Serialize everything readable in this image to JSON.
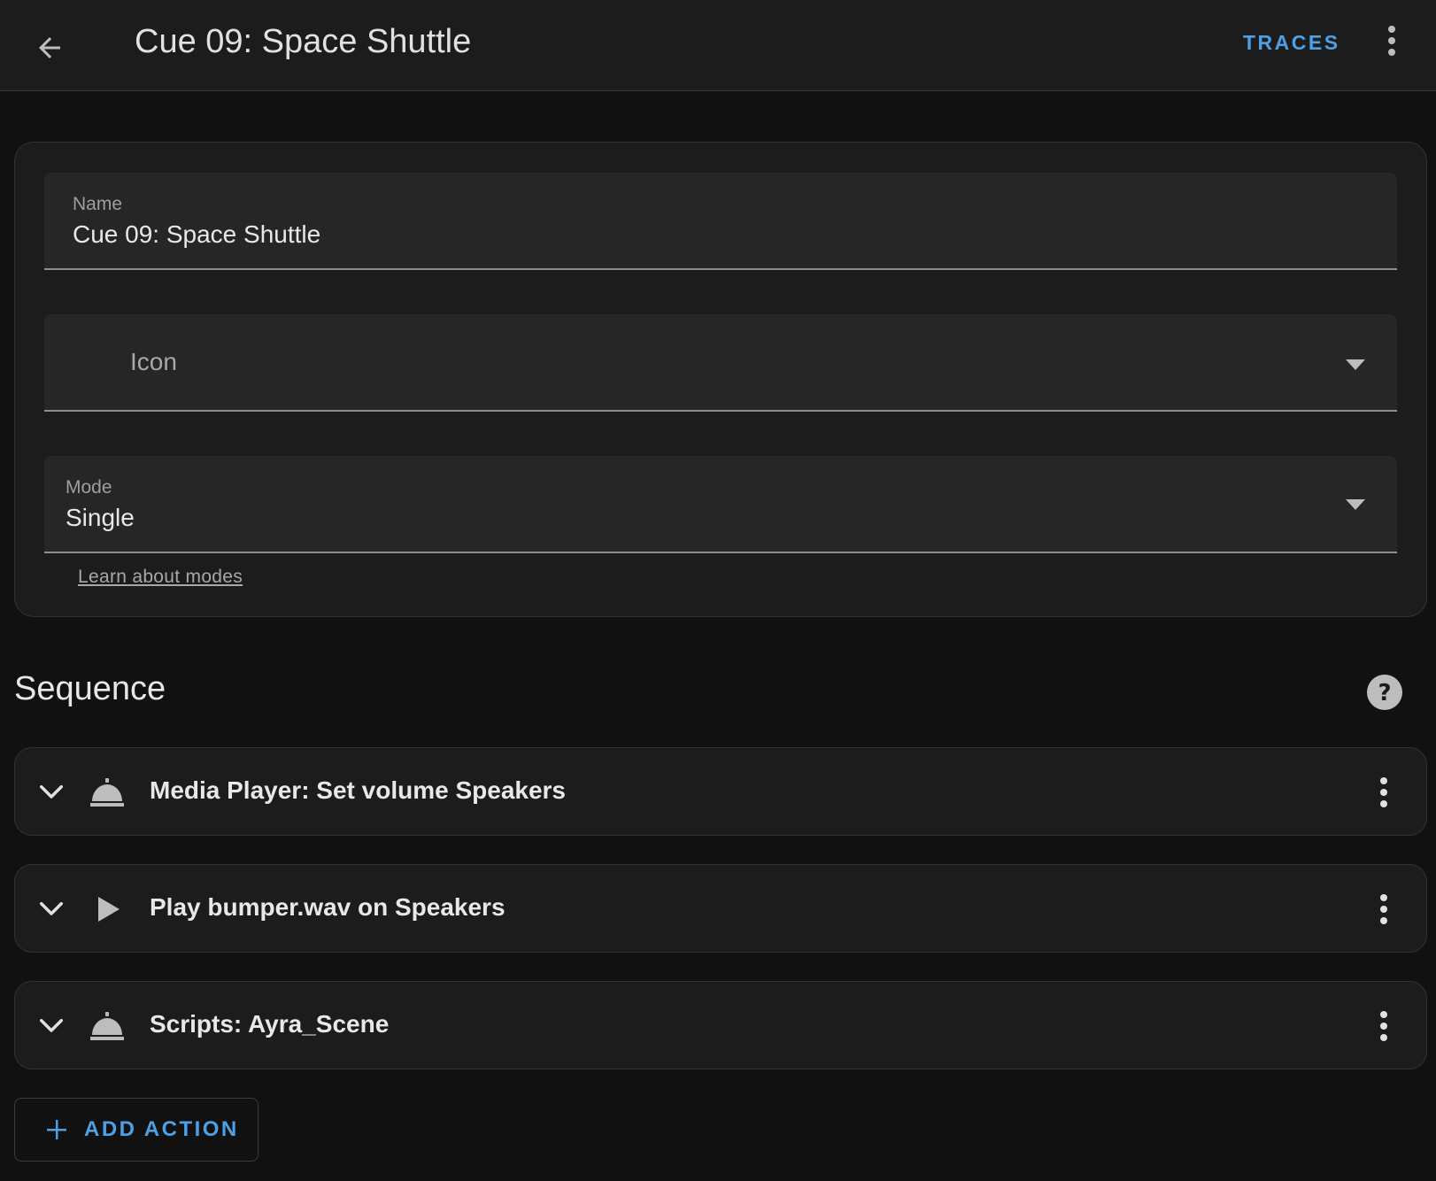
{
  "header": {
    "title": "Cue 09: Space Shuttle",
    "traces_label": "TRACES",
    "back_icon": "arrow-left-icon",
    "menu_icon": "dots-vertical-icon"
  },
  "details": {
    "name_label": "Name",
    "name_value": "Cue 09: Space Shuttle",
    "icon_placeholder": "Icon",
    "mode_label": "Mode",
    "mode_value": "Single",
    "learn_link": "Learn about modes"
  },
  "sequence": {
    "title": "Sequence",
    "help_icon": "help-circle-icon",
    "actions": [
      {
        "label": "Media Player: Set volume Speakers",
        "icon": "room-service-icon"
      },
      {
        "label": "Play bumper.wav on Speakers",
        "icon": "play-icon"
      },
      {
        "label": "Scripts: Ayra_Scene",
        "icon": "room-service-icon"
      }
    ],
    "add_action_label": "ADD ACTION"
  },
  "colors": {
    "accent": "#4ea0e6",
    "background": "#111111",
    "surface": "#1c1c1c",
    "field": "#262626"
  }
}
